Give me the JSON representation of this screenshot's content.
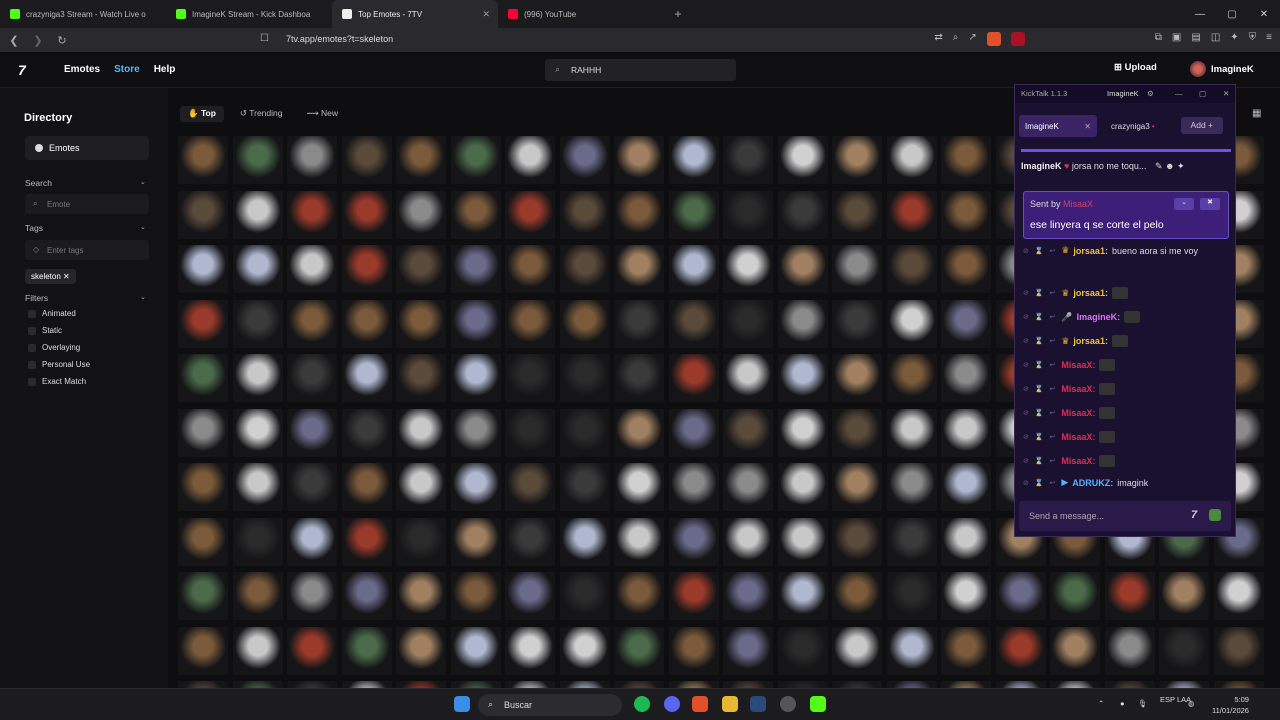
{
  "tabs": [
    {
      "title": "crazyniga3 Stream - Watch Live o",
      "color": "#53fc18"
    },
    {
      "title": "ImagineK Stream - Kick Dashboa",
      "color": "#53fc18"
    },
    {
      "title": "Top Emotes - 7TV",
      "color": "#ffffff"
    },
    {
      "title": "(996) YouTube",
      "color": "#ff0033"
    }
  ],
  "url": "7tv.app/emotes?t=skeleton",
  "header": {
    "logo": "7",
    "emotes": "Emotes",
    "store": "Store",
    "help": "Help",
    "search_value": "RAHHH",
    "upload": "Upload",
    "username": "ImagineK"
  },
  "sidebar": {
    "title": "Directory",
    "emotes_button": "Emotes",
    "search_label": "Search",
    "search_placeholder": "Emote",
    "tags_label": "Tags",
    "tags_placeholder": "Enter tags",
    "tag_chip": "skeleton ✕",
    "filters_label": "Filters",
    "filters": [
      "Animated",
      "Static",
      "Overlaying",
      "Personal Use",
      "Exact Match"
    ]
  },
  "filter_tabs": [
    "Top",
    "Trending",
    "New"
  ],
  "kicktalk": {
    "version": "KickTalk 1.1.3",
    "user": "ImagineK",
    "tab1": "ImagineK",
    "tab2": "crazyniga3",
    "add": "Add +",
    "header_user": "ImagineK",
    "header_text": "jorsa no me toqu...",
    "popup_sent_by": "Sent by",
    "popup_sender": "MisaaX",
    "popup_message": "ese linyera q se corte el pelo",
    "messages": [
      {
        "name": "jorsaa1:",
        "text": "bueno aora si me voy",
        "color": "#f0c040",
        "badge": "crown"
      },
      {
        "name": "jorsaa1:",
        "text": "",
        "color": "#f0c040",
        "badge": "crown"
      },
      {
        "name": "ImagineK:",
        "text": "",
        "color": "#e070ff",
        "badge": "mic"
      },
      {
        "name": "jorsaa1:",
        "text": "",
        "color": "#f0c040",
        "badge": "crown"
      },
      {
        "name": "MisaaX:",
        "text": "",
        "color": "#e03050",
        "badge": ""
      },
      {
        "name": "MisaaX:",
        "text": "",
        "color": "#e03050",
        "badge": ""
      },
      {
        "name": "MisaaX:",
        "text": "",
        "color": "#e03050",
        "badge": ""
      },
      {
        "name": "MisaaX:",
        "text": "",
        "color": "#e03050",
        "badge": ""
      },
      {
        "name": "MisaaX:",
        "text": "",
        "color": "#e03050",
        "badge": ""
      },
      {
        "name": "ADRUKZ:",
        "text": "imagink",
        "color": "#5ab0ff",
        "badge": "kick"
      }
    ],
    "input_placeholder": "Send a message..."
  },
  "taskbar": {
    "search": "Buscar",
    "lang": "ESP\nLAA",
    "time": "5:09",
    "date": "11/01/2026"
  }
}
